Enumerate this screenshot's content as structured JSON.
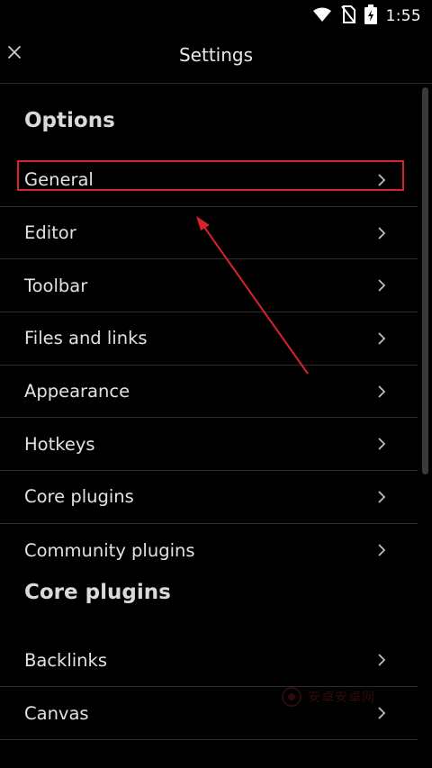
{
  "status_bar": {
    "time": "1:55",
    "icons": [
      "wifi-icon",
      "no-sim-icon",
      "battery-charging-icon"
    ]
  },
  "header": {
    "title": "Settings",
    "close_icon": "close-icon"
  },
  "sections": {
    "options": {
      "heading": "Options",
      "items": [
        {
          "label": "General"
        },
        {
          "label": "Editor"
        },
        {
          "label": "Toolbar"
        },
        {
          "label": "Files and links"
        },
        {
          "label": "Appearance"
        },
        {
          "label": "Hotkeys"
        },
        {
          "label": "Core plugins"
        },
        {
          "label": "Community plugins"
        }
      ]
    },
    "core_plugins": {
      "heading": "Core plugins",
      "items": [
        {
          "label": "Backlinks"
        },
        {
          "label": "Canvas"
        }
      ]
    }
  },
  "annotation": {
    "color": "#d9232a",
    "highlighted_item": "General"
  },
  "watermark": {
    "text": "安卓安卓网"
  }
}
